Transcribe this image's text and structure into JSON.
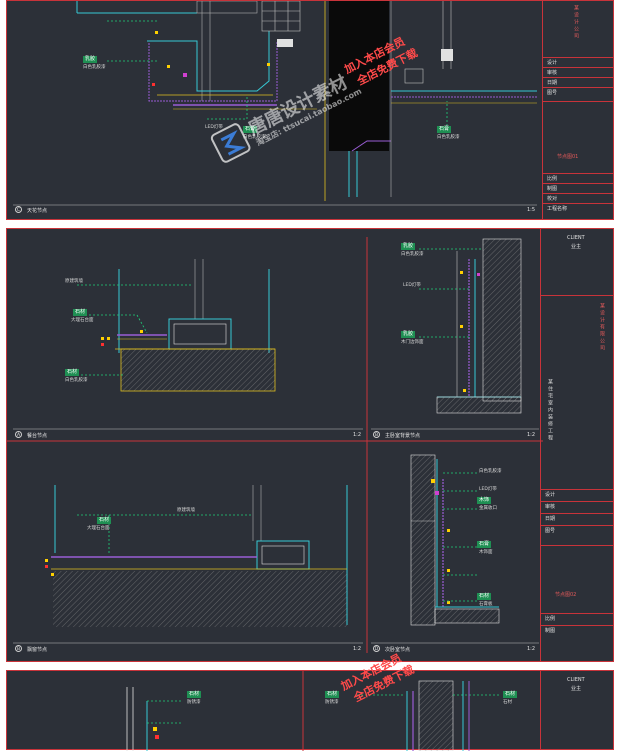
{
  "sheet1": {
    "detail_label": "天花节点",
    "detail_letter": "C",
    "scale": "1:5",
    "tags": [
      {
        "text": "乳胶"
      },
      {
        "text": "石膏"
      },
      {
        "text": "石膏"
      }
    ],
    "annotations": [
      "白色乳胶漆",
      "LED灯带",
      "白色乳胶漆",
      "白色乳胶漆"
    ],
    "titleblock": {
      "top_text": "某设计公司",
      "rows": [
        "设计",
        "审核",
        "日期",
        "图号",
        "比例",
        "制图",
        "校对",
        "工程名称"
      ],
      "sheet_title": "节点图01"
    }
  },
  "sheet2": {
    "details": [
      {
        "letter": "A",
        "name": "餐台节点",
        "scale": "1:2"
      },
      {
        "letter": "B",
        "name": "主卧室背景节点",
        "scale": "1:2"
      },
      {
        "letter": "B",
        "name": "飘窗节点",
        "scale": "1:2"
      },
      {
        "letter": "D",
        "name": "次卧室节点",
        "scale": "1:2"
      }
    ],
    "tags": [
      "石材",
      "石材",
      "乳胶",
      "乳胶",
      "石材",
      "木饰",
      "石膏",
      "石膏",
      "乳胶",
      "石材"
    ],
    "annotations": {
      "a": [
        "原建筑墙",
        "大理石台面",
        "白色乳胶漆"
      ],
      "b": [
        "白色乳胶漆",
        "LED灯带",
        "木门边饰面"
      ],
      "c": [
        "原建筑墙",
        "大理石台面"
      ],
      "d": [
        "白色乳胶漆",
        "LED灯带",
        "金属收口",
        "暗藏灯带",
        "木饰面",
        "石膏板",
        "原建筑墙"
      ]
    },
    "titleblock": {
      "client_label": "CLIENT",
      "client_value": "业主",
      "project": "某住宅室内装修工程",
      "company": "某设计有限公司",
      "rows": [
        "设计",
        "审核",
        "日期",
        "图号",
        "比例",
        "制图"
      ],
      "sheet_title": "节点图02"
    }
  },
  "sheet3": {
    "tags": [
      "石材",
      "石材",
      "石材"
    ],
    "annotations": [
      "防锈漆",
      "防锈漆",
      "石材"
    ],
    "titleblock": {
      "client_label": "CLIENT",
      "client_value": "业主"
    }
  },
  "watermark": {
    "brand": "唐唐设计素材",
    "site": "淘宝店: ttsucai.taobao.com",
    "promo_line1": "加入本店会员",
    "promo_line2": "全店免费下载"
  }
}
